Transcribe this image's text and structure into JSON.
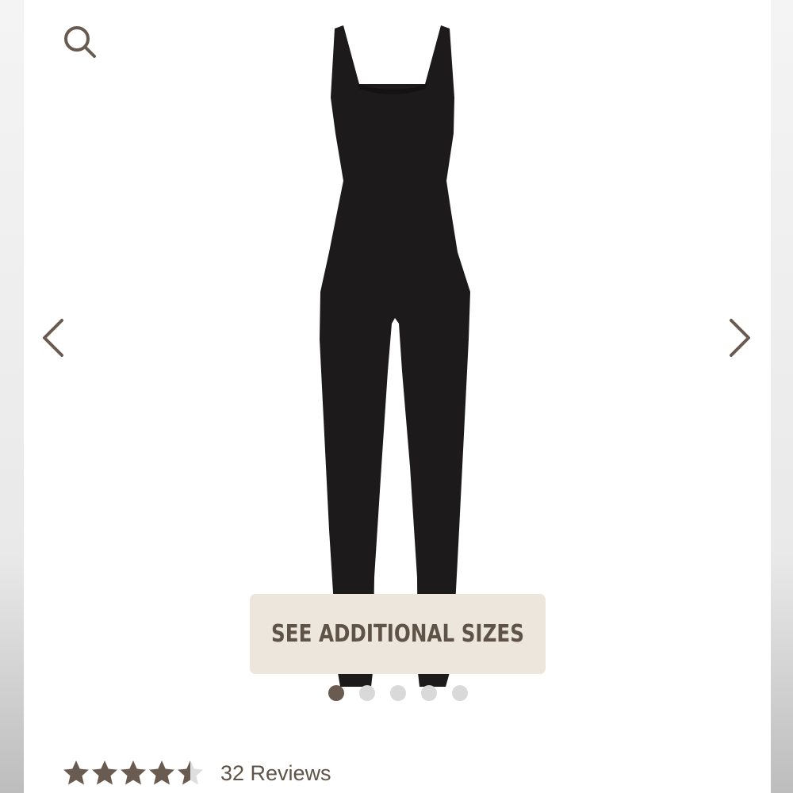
{
  "carousel": {
    "size_button_label": "SEE ADDITIONAL SIZES",
    "slide_count": 5,
    "active_slide": 1
  },
  "rating": {
    "score": 4.5,
    "max": 5,
    "reviews_label": "32 Reviews"
  },
  "icons": {
    "search": "search-icon",
    "prev": "chevron-left-icon",
    "next": "chevron-right-icon",
    "star": "star-icon"
  },
  "colors": {
    "accent": "#6a5b50",
    "button_bg": "#ede6dd",
    "button_text": "#5f5347",
    "garment": "#1c1a1a",
    "dot_inactive": "#d9d9d9",
    "star_empty": "#dedede"
  }
}
